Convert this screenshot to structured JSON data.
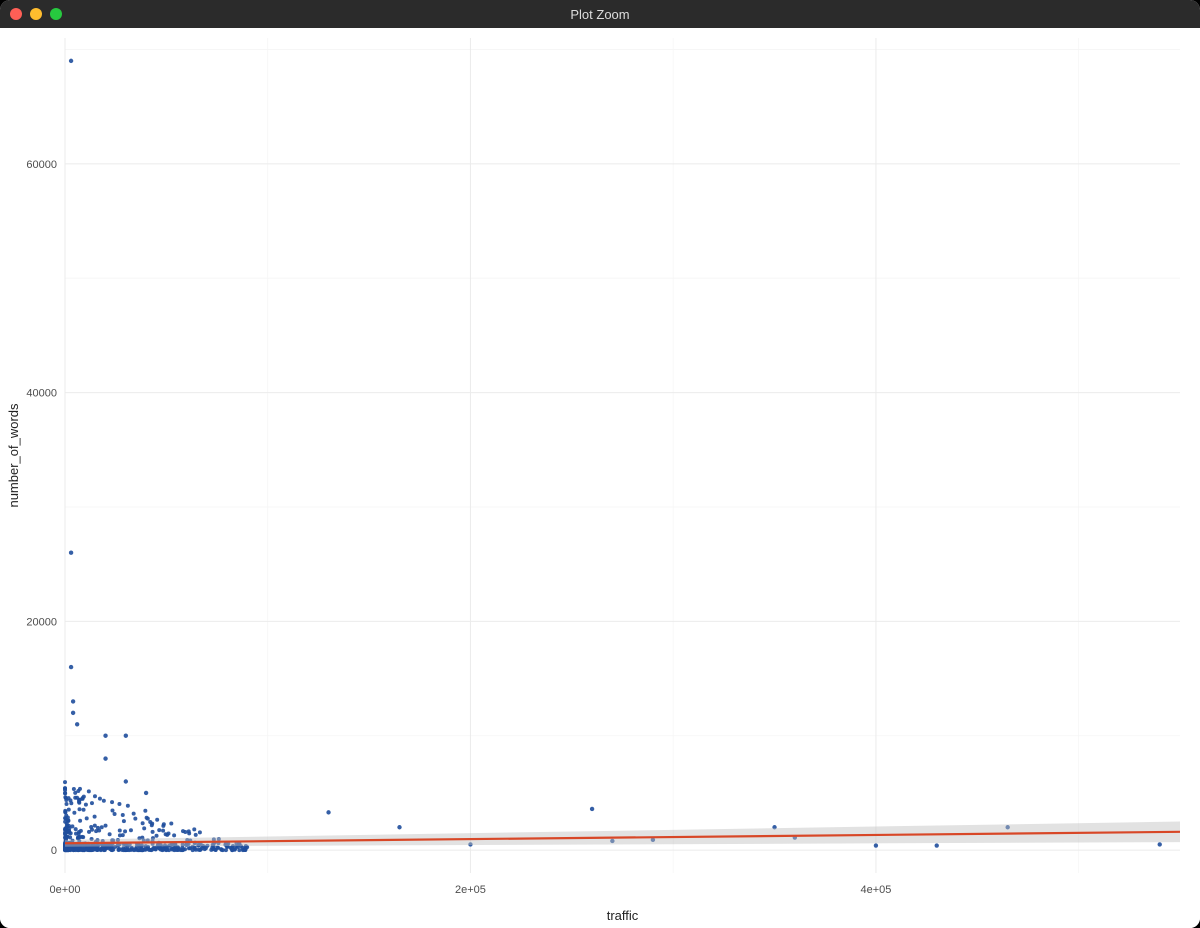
{
  "window": {
    "title": "Plot Zoom"
  },
  "chart_data": {
    "type": "scatter",
    "xlabel": "traffic",
    "ylabel": "number_of_words",
    "xlim": [
      0,
      550000
    ],
    "ylim": [
      -2000,
      71000
    ],
    "x_ticks": [
      0,
      200000,
      400000
    ],
    "x_tick_labels": [
      "0e+00",
      "2e+05",
      "4e+05"
    ],
    "x_minor_ticks": [
      100000,
      300000,
      500000
    ],
    "y_ticks": [
      0,
      20000,
      40000,
      60000
    ],
    "y_minor_ticks": [
      10000,
      30000,
      50000,
      70000
    ],
    "regression": {
      "type": "linear",
      "x": [
        0,
        550000
      ],
      "y": [
        600,
        1600
      ],
      "se_low": [
        300,
        700
      ],
      "se_high": [
        900,
        2500
      ]
    },
    "outliers": [
      {
        "traffic": 3000,
        "words": 69000
      },
      {
        "traffic": 3000,
        "words": 26000
      },
      {
        "traffic": 3000,
        "words": 16000
      },
      {
        "traffic": 4000,
        "words": 13000
      },
      {
        "traffic": 4000,
        "words": 12000
      },
      {
        "traffic": 6000,
        "words": 11000
      },
      {
        "traffic": 20000,
        "words": 10000
      },
      {
        "traffic": 20000,
        "words": 8000
      },
      {
        "traffic": 30000,
        "words": 10000
      },
      {
        "traffic": 30000,
        "words": 6000
      },
      {
        "traffic": 40000,
        "words": 5000
      },
      {
        "traffic": 130000,
        "words": 3300
      },
      {
        "traffic": 165000,
        "words": 2000
      },
      {
        "traffic": 200000,
        "words": 500
      },
      {
        "traffic": 260000,
        "words": 3600
      },
      {
        "traffic": 270000,
        "words": 800
      },
      {
        "traffic": 290000,
        "words": 900
      },
      {
        "traffic": 350000,
        "words": 2000
      },
      {
        "traffic": 360000,
        "words": 1100
      },
      {
        "traffic": 400000,
        "words": 400
      },
      {
        "traffic": 430000,
        "words": 400
      },
      {
        "traffic": 465000,
        "words": 2000
      },
      {
        "traffic": 540000,
        "words": 500
      }
    ],
    "dense_cluster": {
      "note": "Approximate dense cluster near origin, traffic roughly 0–90000, words roughly 0–6000; density highest for traffic<15000.",
      "x_range": [
        0,
        90000
      ],
      "y_range": [
        0,
        6000
      ],
      "approx_n": 600
    }
  }
}
